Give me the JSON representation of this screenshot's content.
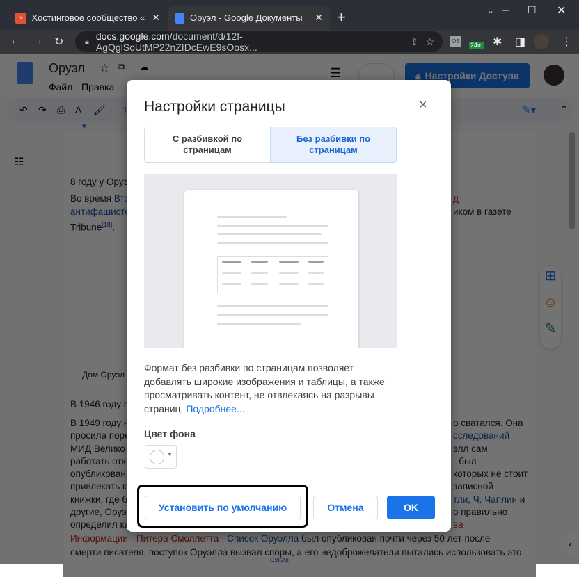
{
  "browser": {
    "tabs": [
      {
        "title": "Хостинговое сообщество «Time"
      },
      {
        "title": "Оруэл - Google Документы",
        "active": true
      }
    ],
    "new_tab": "+",
    "url_domain": "docs.google.com",
    "url_path": "/document/d/12f-AgQglSoUtMP22nZIDcEwE9sOosx...",
    "ext_badge": "24m",
    "ext_os": "OS"
  },
  "docs": {
    "title": "Оруэл",
    "menu": [
      "Файл",
      "Правка"
    ],
    "share_label": "Настройки Доступа",
    "zoom_fragment": "1"
  },
  "document": {
    "lines_left": [
      "8 году у Оруэ",
      "Во время",
      "Вто",
      "антифашисто",
      "Tribune",
      "[18]",
      ".",
      "Дом Оруэл",
      "В 1946 году п",
      "В 1949 году н",
      "просила поре",
      "МИД Велико",
      "работать отк",
      "опубликован",
      "привлекать к",
      "книжки, где б",
      "другие, Оруэ",
      "определил ка"
    ],
    "lines_right": [
      "д",
      "иком в газете",
      "о сватался. Она",
      "сследований",
      "элл сам",
      "- был",
      "которых не стоит",
      "записной",
      "тли, Ч. Чаплин",
      " и",
      "о правильно",
      "ва"
    ],
    "bottom1": {
      "red1": "Информации",
      "red2": "Питера Смоллетта",
      "link": "Список Оруэлла",
      "text": " был опубликован почти через 50 лет после"
    },
    "bottom2": "смерти писателя, поступок Оруэлла вызвал споры, а его недоброжелатели пытались использовать это",
    "bottom3": "[19][20]"
  },
  "dialog": {
    "title": "Настройки страницы",
    "close": "×",
    "options": [
      {
        "label": "С разбивкой по страницам",
        "selected": false
      },
      {
        "label": "Без разбивки по страницам",
        "selected": true
      }
    ],
    "description": "Формат без разбивки по страницам позволяет добавлять широкие изображения и таблицы, а также просматривать контент, не отвлекаясь на разрывы страниц. ",
    "learn_more": "Подробнее...",
    "bg_color_label": "Цвет фона",
    "bg_color": "#ffffff",
    "buttons": {
      "default": "Установить по умолчанию",
      "cancel": "Отмена",
      "ok": "OK"
    }
  },
  "colors": {
    "accent": "#1a73e8",
    "selected_bg": "#e8f0fe"
  }
}
